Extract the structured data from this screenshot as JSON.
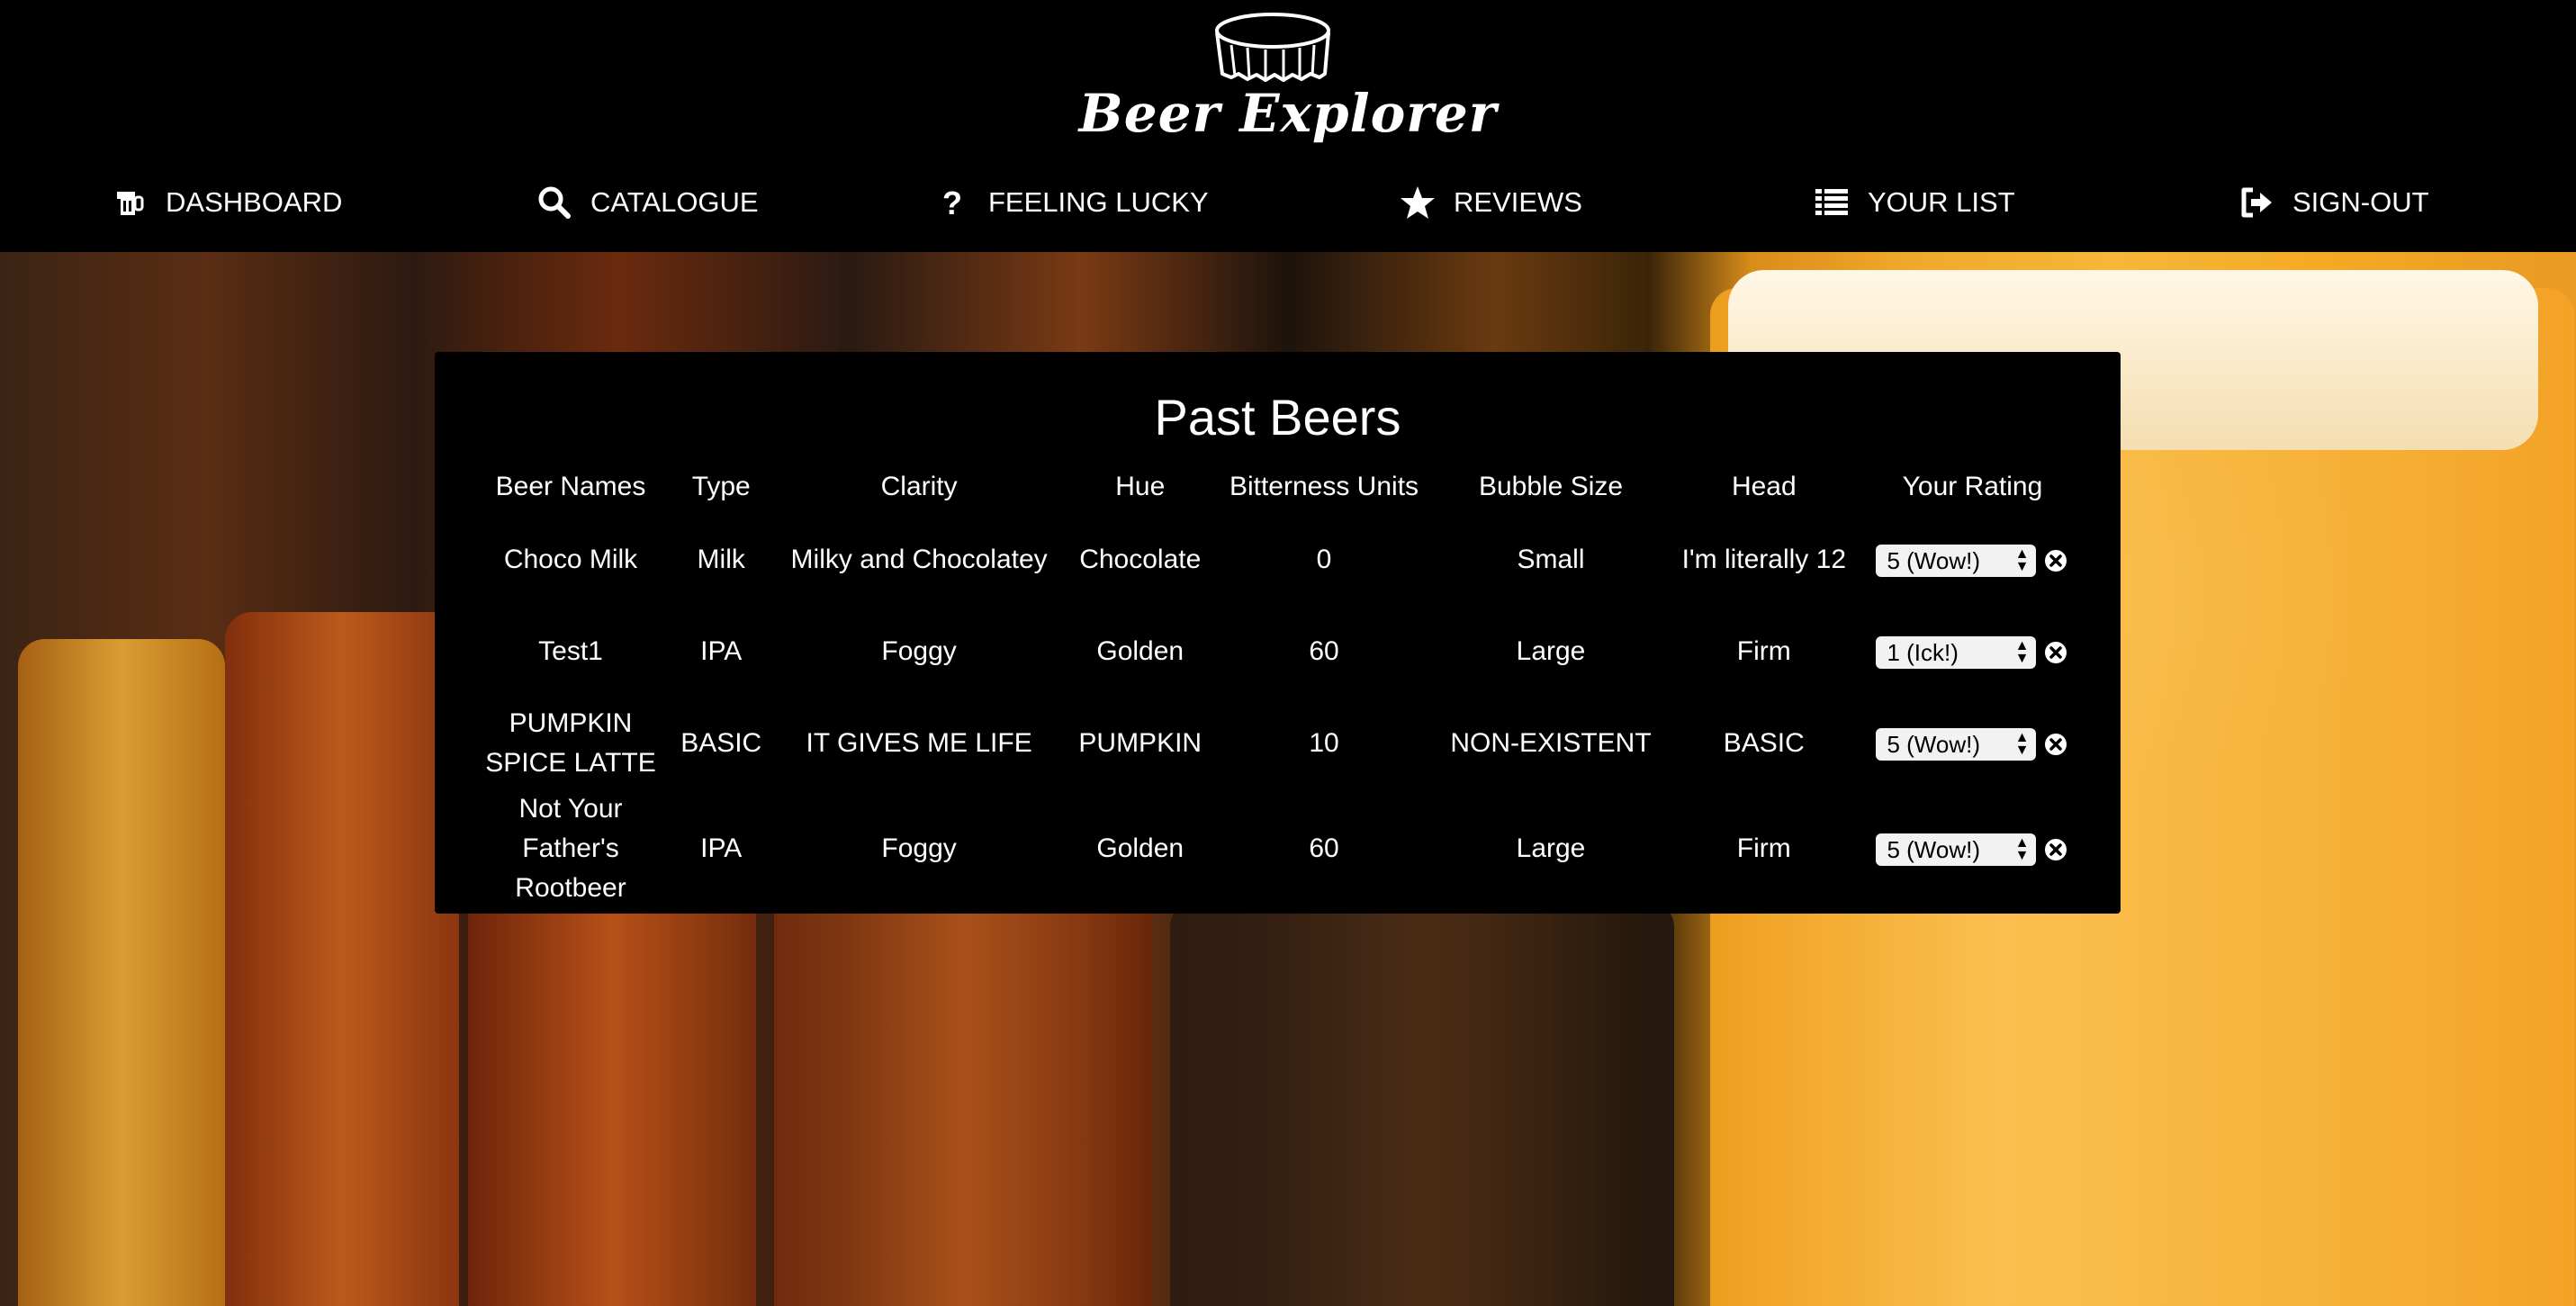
{
  "app": {
    "logo_text": "Beer Explorer"
  },
  "nav": [
    {
      "id": "dashboard",
      "label": "DASHBOARD",
      "icon": "beer-mug-icon"
    },
    {
      "id": "catalogue",
      "label": "CATALOGUE",
      "icon": "search-icon"
    },
    {
      "id": "feeling-lucky",
      "label": "FEELING LUCKY",
      "icon": "question-icon"
    },
    {
      "id": "reviews",
      "label": "REVIEWS",
      "icon": "star-icon"
    },
    {
      "id": "your-list",
      "label": "YOUR LIST",
      "icon": "list-icon"
    },
    {
      "id": "sign-out",
      "label": "SIGN-OUT",
      "icon": "sign-out-icon"
    }
  ],
  "panel": {
    "title": "Past Beers",
    "columns": [
      "Beer Names",
      "Type",
      "Clarity",
      "Hue",
      "Bitterness Units",
      "Bubble Size",
      "Head",
      "Your Rating"
    ],
    "rows": [
      {
        "name": "Choco Milk",
        "type": "Milk",
        "clarity": "Milky and Chocolatey",
        "hue": "Chocolate",
        "bitterness": "0",
        "bubble": "Small",
        "head": "I'm literally 12",
        "rating": "5 (Wow!)"
      },
      {
        "name": "Test1",
        "type": "IPA",
        "clarity": "Foggy",
        "hue": "Golden",
        "bitterness": "60",
        "bubble": "Large",
        "head": "Firm",
        "rating": "1 (Ick!)"
      },
      {
        "name": "PUMPKIN SPICE LATTE",
        "type": "BASIC",
        "clarity": "IT GIVES ME LIFE",
        "hue": "PUMPKIN",
        "bitterness": "10",
        "bubble": "NON-EXISTENT",
        "head": "BASIC",
        "rating": "5 (Wow!)"
      },
      {
        "name": "Not Your Father's Rootbeer",
        "type": "IPA",
        "clarity": "Foggy",
        "hue": "Golden",
        "bitterness": "60",
        "bubble": "Large",
        "head": "Firm",
        "rating": "5 (Wow!)"
      }
    ]
  },
  "colors": {
    "background": "#000000",
    "text": "#ffffff",
    "select_bg": "#f2f2f2"
  }
}
